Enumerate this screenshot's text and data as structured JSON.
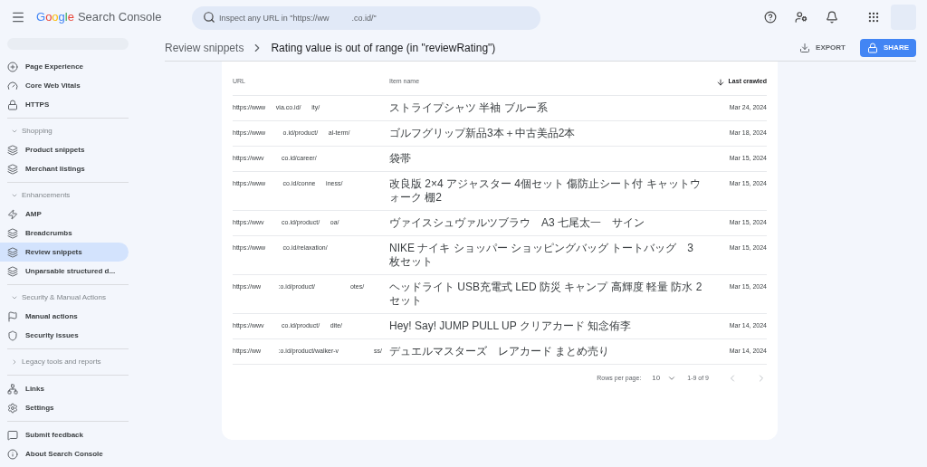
{
  "header": {
    "logo": "Google",
    "product": "Search Console",
    "search": {
      "placeholder": "Inspect any URL in \"https://ww          .co.id/\""
    }
  },
  "sidebar": {
    "sections": [
      {
        "items": [
          {
            "label": "Page Experience",
            "selected": false
          },
          {
            "label": "Core Web Vitals",
            "selected": false
          },
          {
            "label": "HTTPS",
            "selected": false
          }
        ]
      },
      {
        "title": "Shopping",
        "expanded": true,
        "items": [
          {
            "label": "Product snippets",
            "selected": false
          },
          {
            "label": "Merchant listings",
            "selected": false
          }
        ]
      },
      {
        "title": "Enhancements",
        "expanded": true,
        "items": [
          {
            "label": "AMP",
            "selected": false
          },
          {
            "label": "Breadcrumbs",
            "selected": false
          },
          {
            "label": "Review snippets",
            "selected": true
          },
          {
            "label": "Unparsable structured d...",
            "selected": false
          }
        ]
      },
      {
        "title": "Security & Manual Actions",
        "expanded": true,
        "items": [
          {
            "label": "Manual actions",
            "selected": false
          },
          {
            "label": "Security issues",
            "selected": false
          }
        ]
      },
      {
        "title": "Legacy tools and reports",
        "expanded": false
      },
      {
        "items": [
          {
            "label": "Links",
            "selected": false
          },
          {
            "label": "Settings",
            "selected": false
          }
        ]
      },
      {
        "items": [
          {
            "label": "Submit feedback",
            "selected": false
          },
          {
            "label": "About Search Console",
            "selected": false
          }
        ]
      }
    ]
  },
  "breadcrumb": [
    "Review snippets",
    "Rating value is out of range (in \"reviewRating\")"
  ],
  "actions": {
    "export": "EXPORT",
    "share": "SHARE"
  },
  "table": {
    "columns": [
      "URL",
      "Item name",
      "Last crawled"
    ],
    "rows": [
      {
        "url": "https://www      via.co.id/      ity/",
        "item": "ストライプシャツ 半袖 ブルー系",
        "date": "Mar 24, 2024"
      },
      {
        "url": "https://www          o.id/product/      al-term/",
        "item": "ゴルフグリップ新品3本＋中古美品2本",
        "date": "Mar 18, 2024"
      },
      {
        "url": "https://wwv          co.id/career/",
        "item": "袋帯",
        "date": "Mar 15, 2024"
      },
      {
        "url": "https://www          co.id/conne      iness/",
        "item": "改良版 2×4 アジャスター 4個セット 傷防止シート付 キャットウォーク 棚2",
        "date": "Mar 15, 2024"
      },
      {
        "url": "https://wwv          co.id/product/      oa/",
        "item": "ヴァイスシュヴァルツブラウ　A3 七尾太一　サイン",
        "date": "Mar 15, 2024"
      },
      {
        "url": "https://www          co.id/relaxation/",
        "item": "NIKE ナイキ ショッパー ショッピングバッグ トートバッグ　3枚セット",
        "date": "Mar 15, 2024"
      },
      {
        "url": "https://ww          :o.id/product/                    otes/",
        "item": "ヘッドライト USB充電式 LED 防災 キャンプ 高輝度 軽量 防水 2セット",
        "date": "Mar 15, 2024"
      },
      {
        "url": "https://wwv          co.id/product/      dite/",
        "item": "Hey! Say! JUMP PULL UP クリアカード 知念侑李",
        "date": "Mar 14, 2024"
      },
      {
        "url": "https://ww          :o.id/product/walker-v                    ss/",
        "item": "デュエルマスターズ　レアカード まとめ売り",
        "date": "Mar 14, 2024"
      }
    ],
    "footer": {
      "rows_label": "Rows per page:",
      "rows_value": "10",
      "range": "1-9 of 9"
    }
  }
}
